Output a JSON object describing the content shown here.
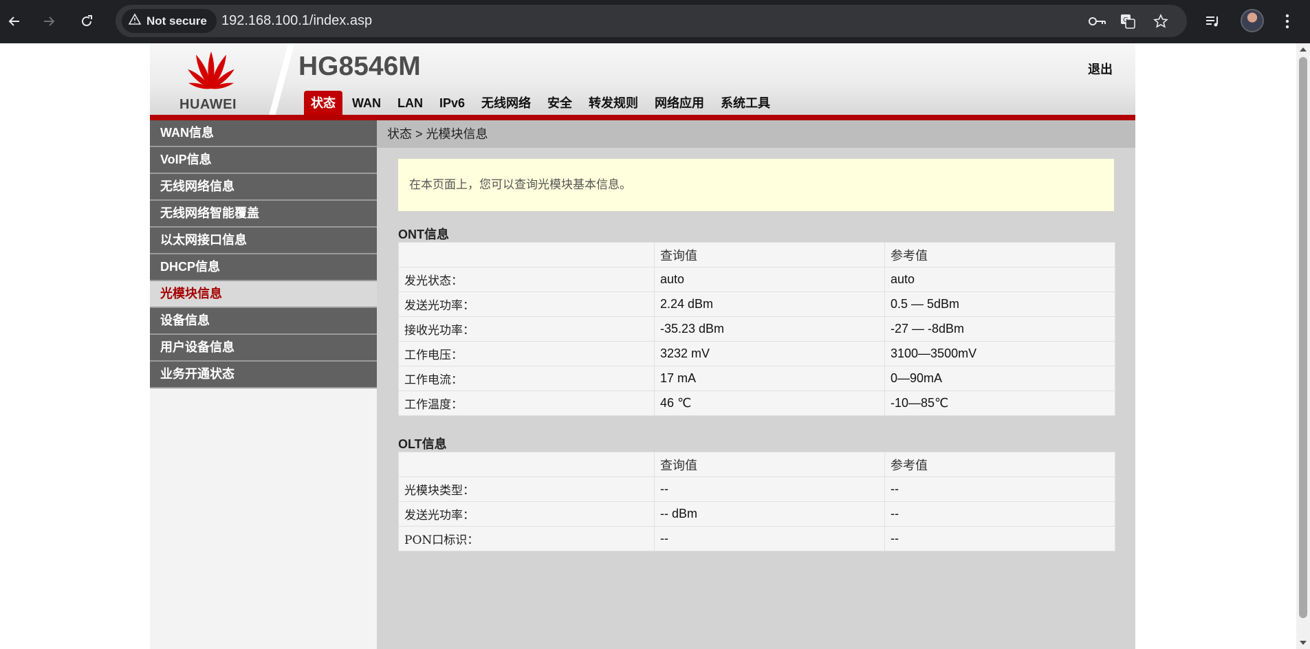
{
  "browser": {
    "security_label": "Not secure",
    "url": "192.168.100.1/index.asp"
  },
  "router": {
    "brand": "HUAWEI",
    "model": "HG8546M",
    "logout": "退出",
    "tabs": [
      {
        "label": "状态",
        "active": true
      },
      {
        "label": "WAN"
      },
      {
        "label": "LAN"
      },
      {
        "label": "IPv6"
      },
      {
        "label": "无线网络"
      },
      {
        "label": "安全"
      },
      {
        "label": "转发规则"
      },
      {
        "label": "网络应用"
      },
      {
        "label": "系统工具"
      }
    ],
    "sidebar": [
      {
        "label": "WAN信息"
      },
      {
        "label": "VoIP信息"
      },
      {
        "label": "无线网络信息"
      },
      {
        "label": "无线网络智能覆盖"
      },
      {
        "label": "以太网接口信息"
      },
      {
        "label": "DHCP信息"
      },
      {
        "label": "光模块信息",
        "active": true
      },
      {
        "label": "设备信息"
      },
      {
        "label": "用户设备信息"
      },
      {
        "label": "业务开通状态"
      }
    ],
    "breadcrumb": "状态 > 光模块信息",
    "info_text": "在本页面上，您可以查询光模块基本信息。",
    "ont": {
      "title": "ONT信息",
      "headers": [
        "",
        "查询值",
        "参考值"
      ],
      "rows": [
        [
          "发光状态：",
          "auto",
          "auto"
        ],
        [
          "发送光功率：",
          "2.24 dBm",
          "0.5 — 5dBm"
        ],
        [
          "接收光功率：",
          "-35.23 dBm",
          "-27 — -8dBm"
        ],
        [
          "工作电压：",
          "3232 mV",
          "3100—3500mV"
        ],
        [
          "工作电流：",
          "17 mA",
          "0—90mA"
        ],
        [
          "工作温度：",
          "46 ℃",
          "-10—85℃"
        ]
      ]
    },
    "olt": {
      "title": "OLT信息",
      "headers": [
        "",
        "查询值",
        "参考值"
      ],
      "rows": [
        [
          "光模块类型：",
          "--",
          "--"
        ],
        [
          "发送光功率：",
          "-- dBm",
          "--"
        ],
        [
          "PON口标识：",
          "--",
          "--"
        ]
      ]
    }
  },
  "colors": {
    "brand_red": "#c00000",
    "sidebar_bg": "#616161",
    "info_bg": "#ffffdd"
  }
}
